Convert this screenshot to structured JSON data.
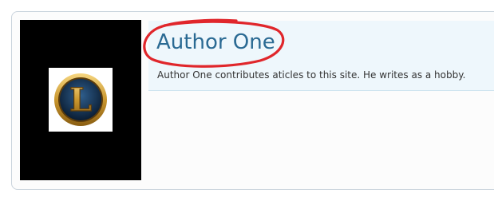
{
  "author": {
    "name": "Author One",
    "bio": "Author One contributes aticles to this site. He writes as a hobby."
  },
  "avatar": {
    "icon": "league-of-legends-logo-icon",
    "letter": "L"
  },
  "colors": {
    "name": "#2a6a93",
    "panel": "#eef7fc",
    "annotation": "#e0262b",
    "badge_gold": "#c9962e",
    "badge_blue": "#1d3b5e"
  }
}
